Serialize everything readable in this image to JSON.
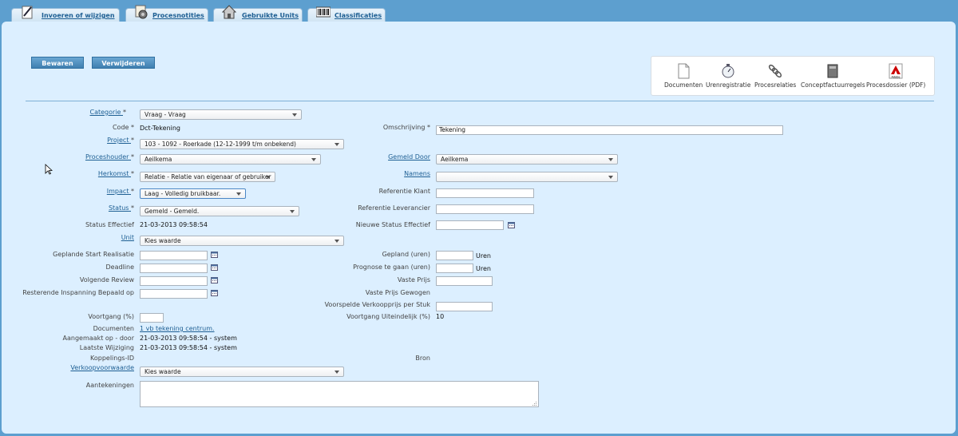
{
  "tabs": [
    {
      "label": "Invoeren of wijzigen",
      "icon": "pencil-icon"
    },
    {
      "label": "Procesnotities",
      "icon": "notes-icon"
    },
    {
      "label": "Gebruikte Units",
      "icon": "house-icon"
    },
    {
      "label": "Classificaties",
      "icon": "barcode-icon"
    }
  ],
  "toolbar": {
    "save": "Bewaren",
    "delete": "Verwijderen"
  },
  "actions": [
    {
      "label": "Documenten",
      "icon": "document-icon"
    },
    {
      "label": "Urenregistratie",
      "icon": "stopwatch-icon"
    },
    {
      "label": "Procesrelaties",
      "icon": "chain-icon"
    },
    {
      "label": "Conceptfactuurregels",
      "icon": "invoice-icon"
    },
    {
      "label": "Procesdossier (PDF)",
      "icon": "adobe-pdf-icon",
      "icon_text": "Adobe"
    }
  ],
  "form": {
    "categorie": {
      "label": "Categorie",
      "req": "*",
      "value": "Vraag - Vraag"
    },
    "code": {
      "label": "Code",
      "req": "*",
      "value": "Dct-Tekening"
    },
    "omschrijving": {
      "label": "Omschrijving",
      "req": "*",
      "value": "Tekening"
    },
    "project": {
      "label": "Project",
      "req": "*",
      "value": "103 - 1092 - Roerkade (12-12-1999 t/m onbekend)"
    },
    "proceshouder": {
      "label": "Proceshouder",
      "req": "*",
      "value": "Aeilkema"
    },
    "gemeld_door": {
      "label": "Gemeld Door",
      "value": "Aeilkema"
    },
    "herkomst": {
      "label": "Herkomst",
      "req": "*",
      "value": "Relatie - Relatie van eigenaar of gebruiker"
    },
    "namens": {
      "label": "Namens",
      "value": ""
    },
    "impact": {
      "label": "Impact",
      "req": "*",
      "value": "Laag - Volledig bruikbaar."
    },
    "referentie_klant": {
      "label": "Referentie Klant",
      "value": ""
    },
    "status": {
      "label": "Status",
      "req": "*",
      "value": "Gemeld - Gemeld."
    },
    "referentie_leverancier": {
      "label": "Referentie Leverancier",
      "value": ""
    },
    "status_effectief": {
      "label": "Status Effectief",
      "value": "21-03-2013 09:58:54"
    },
    "nieuwe_status_effectief": {
      "label": "Nieuwe Status Effectief",
      "value": ""
    },
    "unit": {
      "label": "Unit",
      "value": "Kies waarde"
    },
    "geplande_start": {
      "label": "Geplande Start Realisatie",
      "value": ""
    },
    "gepland_uren": {
      "label": "Gepland (uren)",
      "value": "",
      "unit": "Uren"
    },
    "deadline": {
      "label": "Deadline",
      "value": ""
    },
    "prognose": {
      "label": "Prognose te gaan (uren)",
      "value": "",
      "unit": "Uren"
    },
    "volgende_review": {
      "label": "Volgende Review",
      "value": ""
    },
    "vaste_prijs": {
      "label": "Vaste Prijs",
      "value": ""
    },
    "resterende": {
      "label": "Resterende Inspanning Bepaald op",
      "value": ""
    },
    "vaste_prijs_gewogen": {
      "label": "Vaste Prijs Gewogen"
    },
    "voorspelde": {
      "label": "Voorspelde Verkoopprijs per Stuk",
      "value": ""
    },
    "voortgang": {
      "label": "Voortgang (%)",
      "value": ""
    },
    "voortgang_uit": {
      "label": "Voortgang Uiteindelijk (%)",
      "value": "10"
    },
    "documenten": {
      "label": "Documenten",
      "value": "1 vb tekening centrum."
    },
    "aangemaakt": {
      "label": "Aangemaakt op - door",
      "value": "21-03-2013 09:58:54 - system"
    },
    "laatste": {
      "label": "Laatste Wijziging",
      "value": "21-03-2013 09:58:54 - system"
    },
    "koppelings": {
      "label": "Koppelings-ID"
    },
    "bron": {
      "label": "Bron"
    },
    "verkoopvoorwaarde": {
      "label": "Verkoopvoorwaarde",
      "value": "Kies waarde"
    },
    "aantekeningen": {
      "label": "Aantekeningen",
      "value": ""
    }
  }
}
